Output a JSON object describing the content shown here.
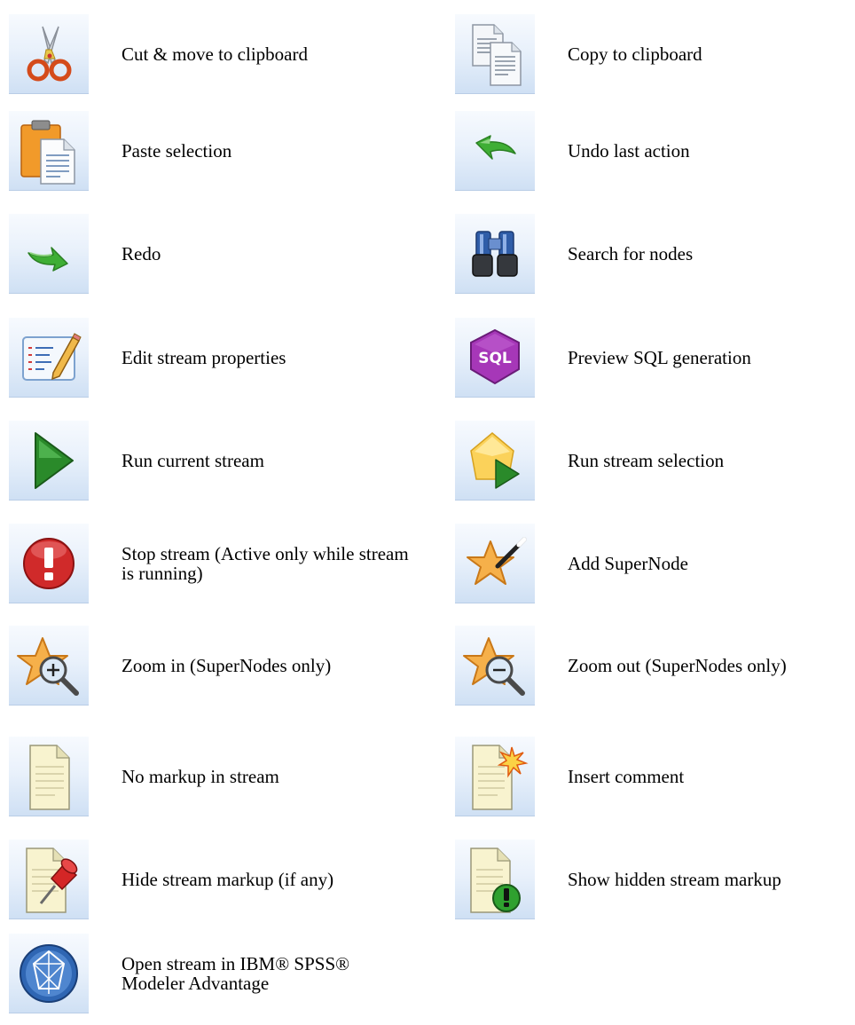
{
  "toolbar_legend": {
    "items": [
      {
        "icon": "cut-icon",
        "label": "Cut & move to clipboard"
      },
      {
        "icon": "copy-icon",
        "label": "Copy to clipboard"
      },
      {
        "icon": "paste-icon",
        "label": "Paste selection"
      },
      {
        "icon": "undo-icon",
        "label": "Undo last action"
      },
      {
        "icon": "redo-icon",
        "label": "Redo"
      },
      {
        "icon": "binoculars-icon",
        "label": "Search for nodes"
      },
      {
        "icon": "edit-properties-icon",
        "label": "Edit stream properties"
      },
      {
        "icon": "sql-icon",
        "label": "Preview SQL generation",
        "text": "SQL"
      },
      {
        "icon": "run-icon",
        "label": "Run current stream"
      },
      {
        "icon": "run-selection-icon",
        "label": "Run stream selection"
      },
      {
        "icon": "stop-icon",
        "label": "Stop stream (Active only while stream is running)"
      },
      {
        "icon": "add-supernode-icon",
        "label": "Add SuperNode"
      },
      {
        "icon": "zoom-in-icon",
        "label": "Zoom in (SuperNodes only)"
      },
      {
        "icon": "zoom-out-icon",
        "label": "Zoom out (SuperNodes only)"
      },
      {
        "icon": "no-markup-icon",
        "label": "No markup in stream"
      },
      {
        "icon": "insert-comment-icon",
        "label": "Insert comment"
      },
      {
        "icon": "hide-markup-icon",
        "label": "Hide stream markup (if any)"
      },
      {
        "icon": "show-markup-icon",
        "label": "Show hidden stream markup"
      },
      {
        "icon": "modeler-advantage-icon",
        "label": "Open stream in IBM® SPSS® Modeler Advantage"
      }
    ]
  }
}
